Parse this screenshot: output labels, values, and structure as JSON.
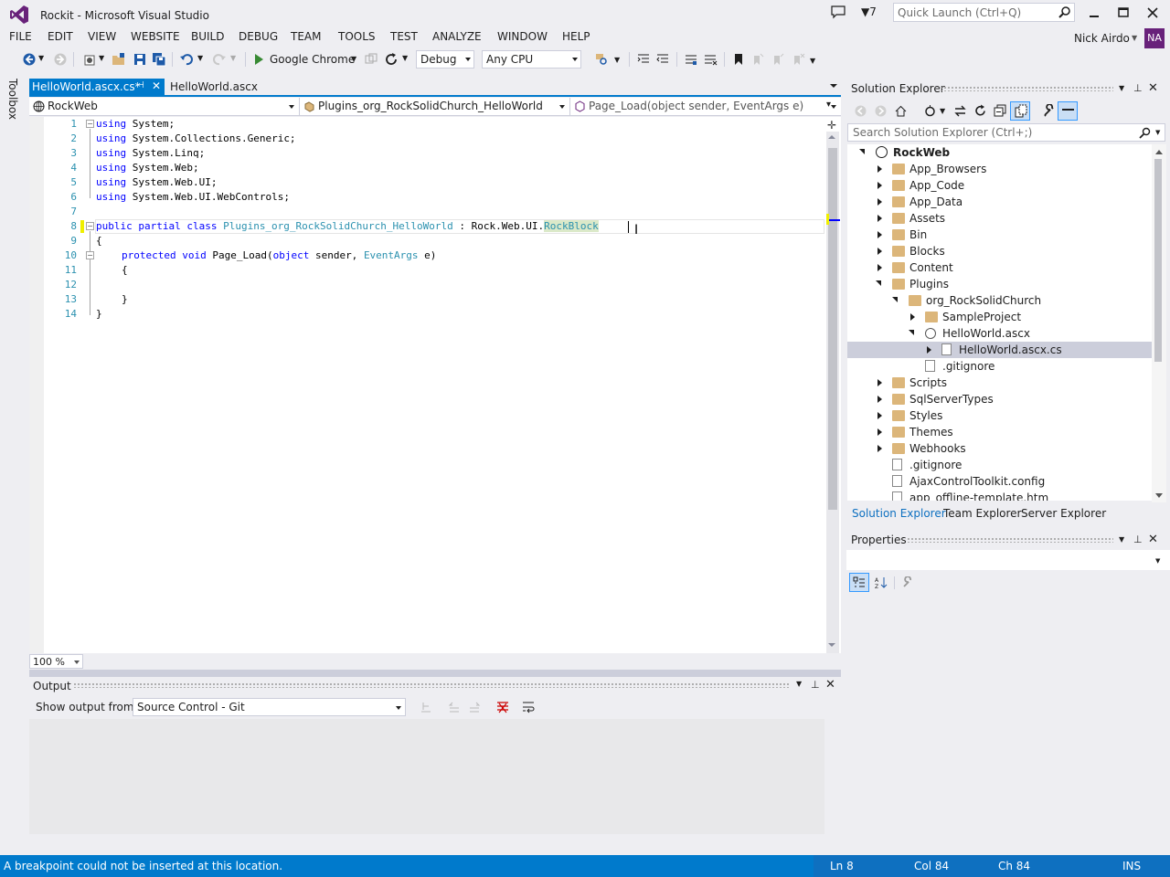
{
  "window": {
    "title": "Rockit - Microsoft Visual Studio",
    "notification_count": "7",
    "quick_launch_placeholder": "Quick Launch (Ctrl+Q)"
  },
  "menu": [
    "FILE",
    "EDIT",
    "VIEW",
    "WEBSITE",
    "BUILD",
    "DEBUG",
    "TEAM",
    "TOOLS",
    "TEST",
    "ANALYZE",
    "WINDOW",
    "HELP"
  ],
  "user": {
    "name": "Nick Airdo",
    "initials": "NA"
  },
  "toolbar": {
    "run_target": "Google Chrome",
    "configuration": "Debug",
    "platform": "Any CPU"
  },
  "toolbox_label": "Toolbox",
  "tabs": [
    {
      "label": "HelloWorld.ascx.cs*",
      "active": true
    },
    {
      "label": "HelloWorld.ascx",
      "active": false
    }
  ],
  "navbar": {
    "project": "RockWeb",
    "type": "Plugins_org_RockSolidChurch_HelloWorld",
    "member": "Page_Load(object sender, EventArgs e)"
  },
  "code": {
    "line_numbers": [
      "1",
      "2",
      "3",
      "4",
      "5",
      "6",
      "7",
      "8",
      "9",
      "10",
      "11",
      "12",
      "13",
      "14"
    ],
    "using_kw": "using",
    "usings": [
      "System;",
      "System.Collections.Generic;",
      "System.Linq;",
      "System.Web;",
      "System.Web.UI;",
      "System.Web.UI.WebControls;"
    ],
    "line8": {
      "kw": "public partial class",
      "name": "Plugins_org_RockSolidChurch_HelloWorld",
      "sep": " : Rock.Web.UI.",
      "base": "RockBlock"
    },
    "open_brace": "{",
    "close_brace": "}",
    "line10": {
      "kw": "protected void",
      "method": " Page_Load(",
      "param_kw": "object",
      "p1": " sender, ",
      "param_type": "EventArgs",
      "p2": " e)"
    }
  },
  "zoom": "100 %",
  "output": {
    "title": "Output",
    "show_from_label": "Show output from:",
    "source": "Source Control - Git"
  },
  "status": {
    "message": "A breakpoint could not be inserted at this location.",
    "ln": "Ln 8",
    "col": "Col 84",
    "ch": "Ch 84",
    "mode": "INS"
  },
  "solution_explorer": {
    "title": "Solution Explorer",
    "search_placeholder": "Search Solution Explorer (Ctrl+;)",
    "tree": [
      {
        "label": "RockWeb",
        "level": 0,
        "expander": "open",
        "icon": "globe-icon",
        "bold": true
      },
      {
        "label": "App_Browsers",
        "level": 1,
        "expander": "closed",
        "icon": "folder-icon"
      },
      {
        "label": "App_Code",
        "level": 1,
        "expander": "closed",
        "icon": "folder-icon"
      },
      {
        "label": "App_Data",
        "level": 1,
        "expander": "closed",
        "icon": "folder-icon"
      },
      {
        "label": "Assets",
        "level": 1,
        "expander": "closed",
        "icon": "folder-icon"
      },
      {
        "label": "Bin",
        "level": 1,
        "expander": "closed",
        "icon": "folder-icon"
      },
      {
        "label": "Blocks",
        "level": 1,
        "expander": "closed",
        "icon": "folder-icon"
      },
      {
        "label": "Content",
        "level": 1,
        "expander": "closed",
        "icon": "folder-icon"
      },
      {
        "label": "Plugins",
        "level": 1,
        "expander": "open",
        "icon": "folder-open-icon"
      },
      {
        "label": "org_RockSolidChurch",
        "level": 2,
        "expander": "open",
        "icon": "folder-open-icon"
      },
      {
        "label": "SampleProject",
        "level": 3,
        "expander": "closed",
        "icon": "folder-icon"
      },
      {
        "label": "HelloWorld.ascx",
        "level": 3,
        "expander": "open",
        "icon": "web-control-icon"
      },
      {
        "label": "HelloWorld.ascx.cs",
        "level": 4,
        "expander": "closed",
        "icon": "cs-file-icon",
        "selected": true
      },
      {
        "label": ".gitignore",
        "level": 3,
        "expander": "none",
        "icon": "file-icon"
      },
      {
        "label": "Scripts",
        "level": 1,
        "expander": "closed",
        "icon": "folder-icon"
      },
      {
        "label": "SqlServerTypes",
        "level": 1,
        "expander": "closed",
        "icon": "folder-icon"
      },
      {
        "label": "Styles",
        "level": 1,
        "expander": "closed",
        "icon": "folder-icon"
      },
      {
        "label": "Themes",
        "level": 1,
        "expander": "closed",
        "icon": "folder-icon"
      },
      {
        "label": "Webhooks",
        "level": 1,
        "expander": "closed",
        "icon": "folder-icon"
      },
      {
        "label": ".gitignore",
        "level": 1,
        "expander": "none",
        "icon": "file-icon"
      },
      {
        "label": "AjaxControlToolkit.config",
        "level": 1,
        "expander": "none",
        "icon": "config-file-icon"
      },
      {
        "label": "app_offline-template.htm",
        "level": 1,
        "expander": "none",
        "icon": "file-icon"
      }
    ],
    "tabs": [
      "Solution Explorer",
      "Team Explorer",
      "Server Explorer"
    ]
  },
  "properties": {
    "title": "Properties"
  },
  "colors": {
    "accent": "#007acc",
    "vs_purple": "#68217a",
    "keyword": "#0000ff",
    "type": "#2b91af"
  }
}
